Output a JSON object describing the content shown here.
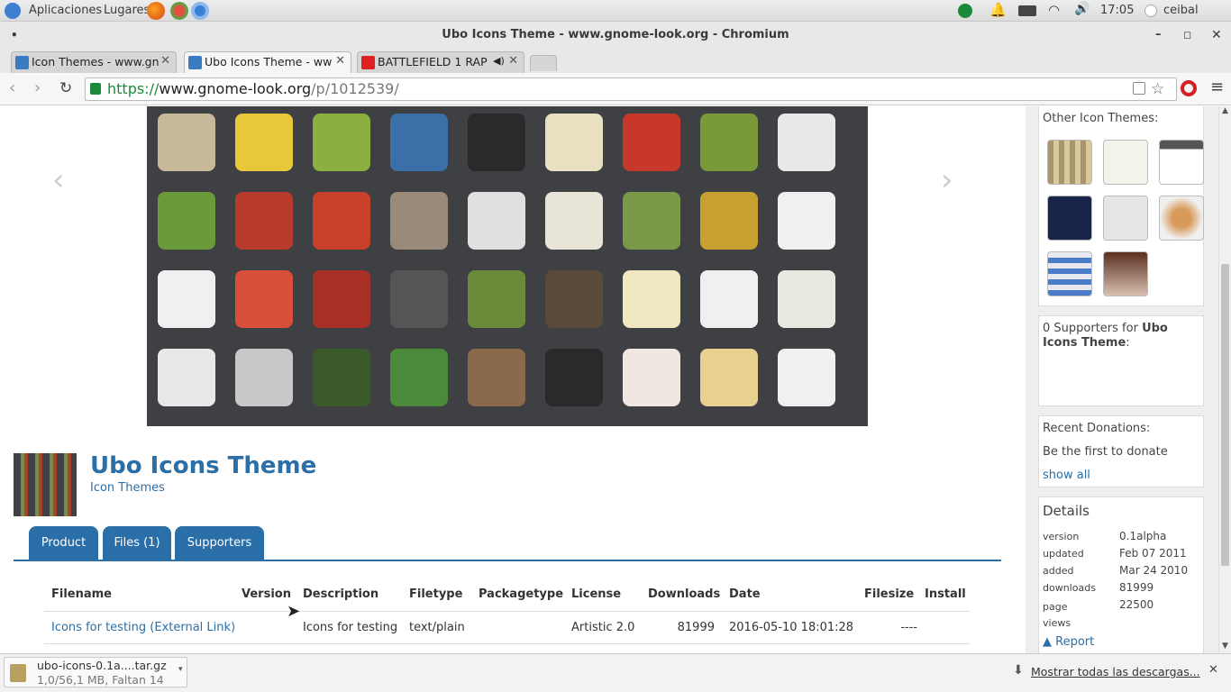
{
  "panel": {
    "apps": "Aplicaciones",
    "places": "Lugares",
    "clock": "17:05",
    "user": "ceibal"
  },
  "window": {
    "title": "Ubo Icons Theme - www.gnome-look.org - Chromium"
  },
  "tabs": [
    {
      "label": "Icon Themes - www.gn"
    },
    {
      "label": "Ubo Icons Theme - ww"
    },
    {
      "label": "BATTLEFIELD 1 RAP"
    }
  ],
  "address": {
    "scheme": "https://",
    "host": "www.gnome-look.org",
    "path": "/p/1012539/"
  },
  "product": {
    "title": "Ubo Icons Theme",
    "category": "Icon Themes"
  },
  "content_tabs": [
    "Product",
    "Files (1)",
    "Supporters"
  ],
  "files": {
    "headers": [
      "Filename",
      "Version",
      "Description",
      "Filetype",
      "Packagetype",
      "License",
      "Downloads",
      "Date",
      "Filesize",
      "Install"
    ],
    "row": {
      "filename": "Icons for testing (External Link)",
      "version": "",
      "description": "Icons for testing",
      "filetype": "text/plain",
      "packagetype": "",
      "license": "Artistic 2.0",
      "downloads": "81999",
      "date": "2016-05-10 18:01:28",
      "filesize": "----",
      "install": ""
    }
  },
  "sidebar": {
    "other_title": "Other Icon Themes:",
    "supporters_prefix": "0 Supporters for ",
    "supporters_name": "Ubo Icons Theme",
    "supporters_suffix": ":",
    "donations_title": "Recent Donations:",
    "donations_text": "Be the first to donate",
    "show_all": "show all",
    "details_title": "Details",
    "details": [
      {
        "k": "version",
        "v": "0.1alpha"
      },
      {
        "k": "updated",
        "v": "Feb 07 2011"
      },
      {
        "k": "added",
        "v": "Mar 24 2010"
      },
      {
        "k": "downloads",
        "v": "81999"
      },
      {
        "k": "page views",
        "v": "22500"
      }
    ],
    "report": "Report"
  },
  "download": {
    "file": "ubo-icons-0.1a....tar.gz",
    "status": "1,0/56,1 MB, Faltan 14",
    "show_all": "Mostrar todas las descargas..."
  },
  "colors": {
    "link": "#2a6fa8",
    "accent": "#2a6fa8",
    "hero_bg": "#3e4044"
  }
}
